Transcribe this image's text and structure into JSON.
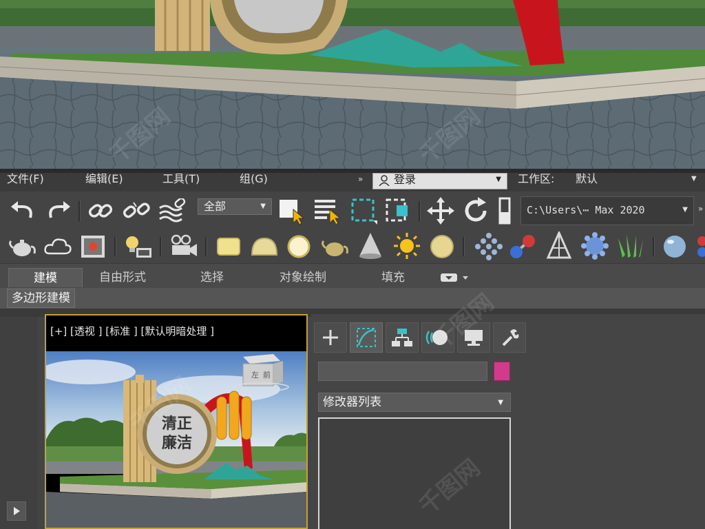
{
  "menu": {
    "file": "文件(F)",
    "edit": "编辑(E)",
    "tools": "工具(T)",
    "group": "组(G)",
    "login": "登录",
    "workspace_label": "工作区:",
    "workspace_value": "默认"
  },
  "toolbar": {
    "selection_filter": "全部",
    "project_path": "C:\\Users\\⋯ Max 2020"
  },
  "ribbon": {
    "tabs": [
      "建模",
      "自由形式",
      "选择",
      "对象绘制",
      "填充"
    ],
    "active_tab": "建模",
    "sub_button": "多边形建模"
  },
  "viewport": {
    "label": "[+] [透视 ] [标准 ] [默认明暗处理 ]",
    "viewcube_face": "左 前",
    "sign_text": "清正 廉洁"
  },
  "command_panel": {
    "modifier_list": "修改器列表",
    "color_swatch": "#d23a8c"
  },
  "colors": {
    "ui_background": "#444444",
    "viewport_border": "#c9a227",
    "accent_cyan": "#39c2c9"
  }
}
